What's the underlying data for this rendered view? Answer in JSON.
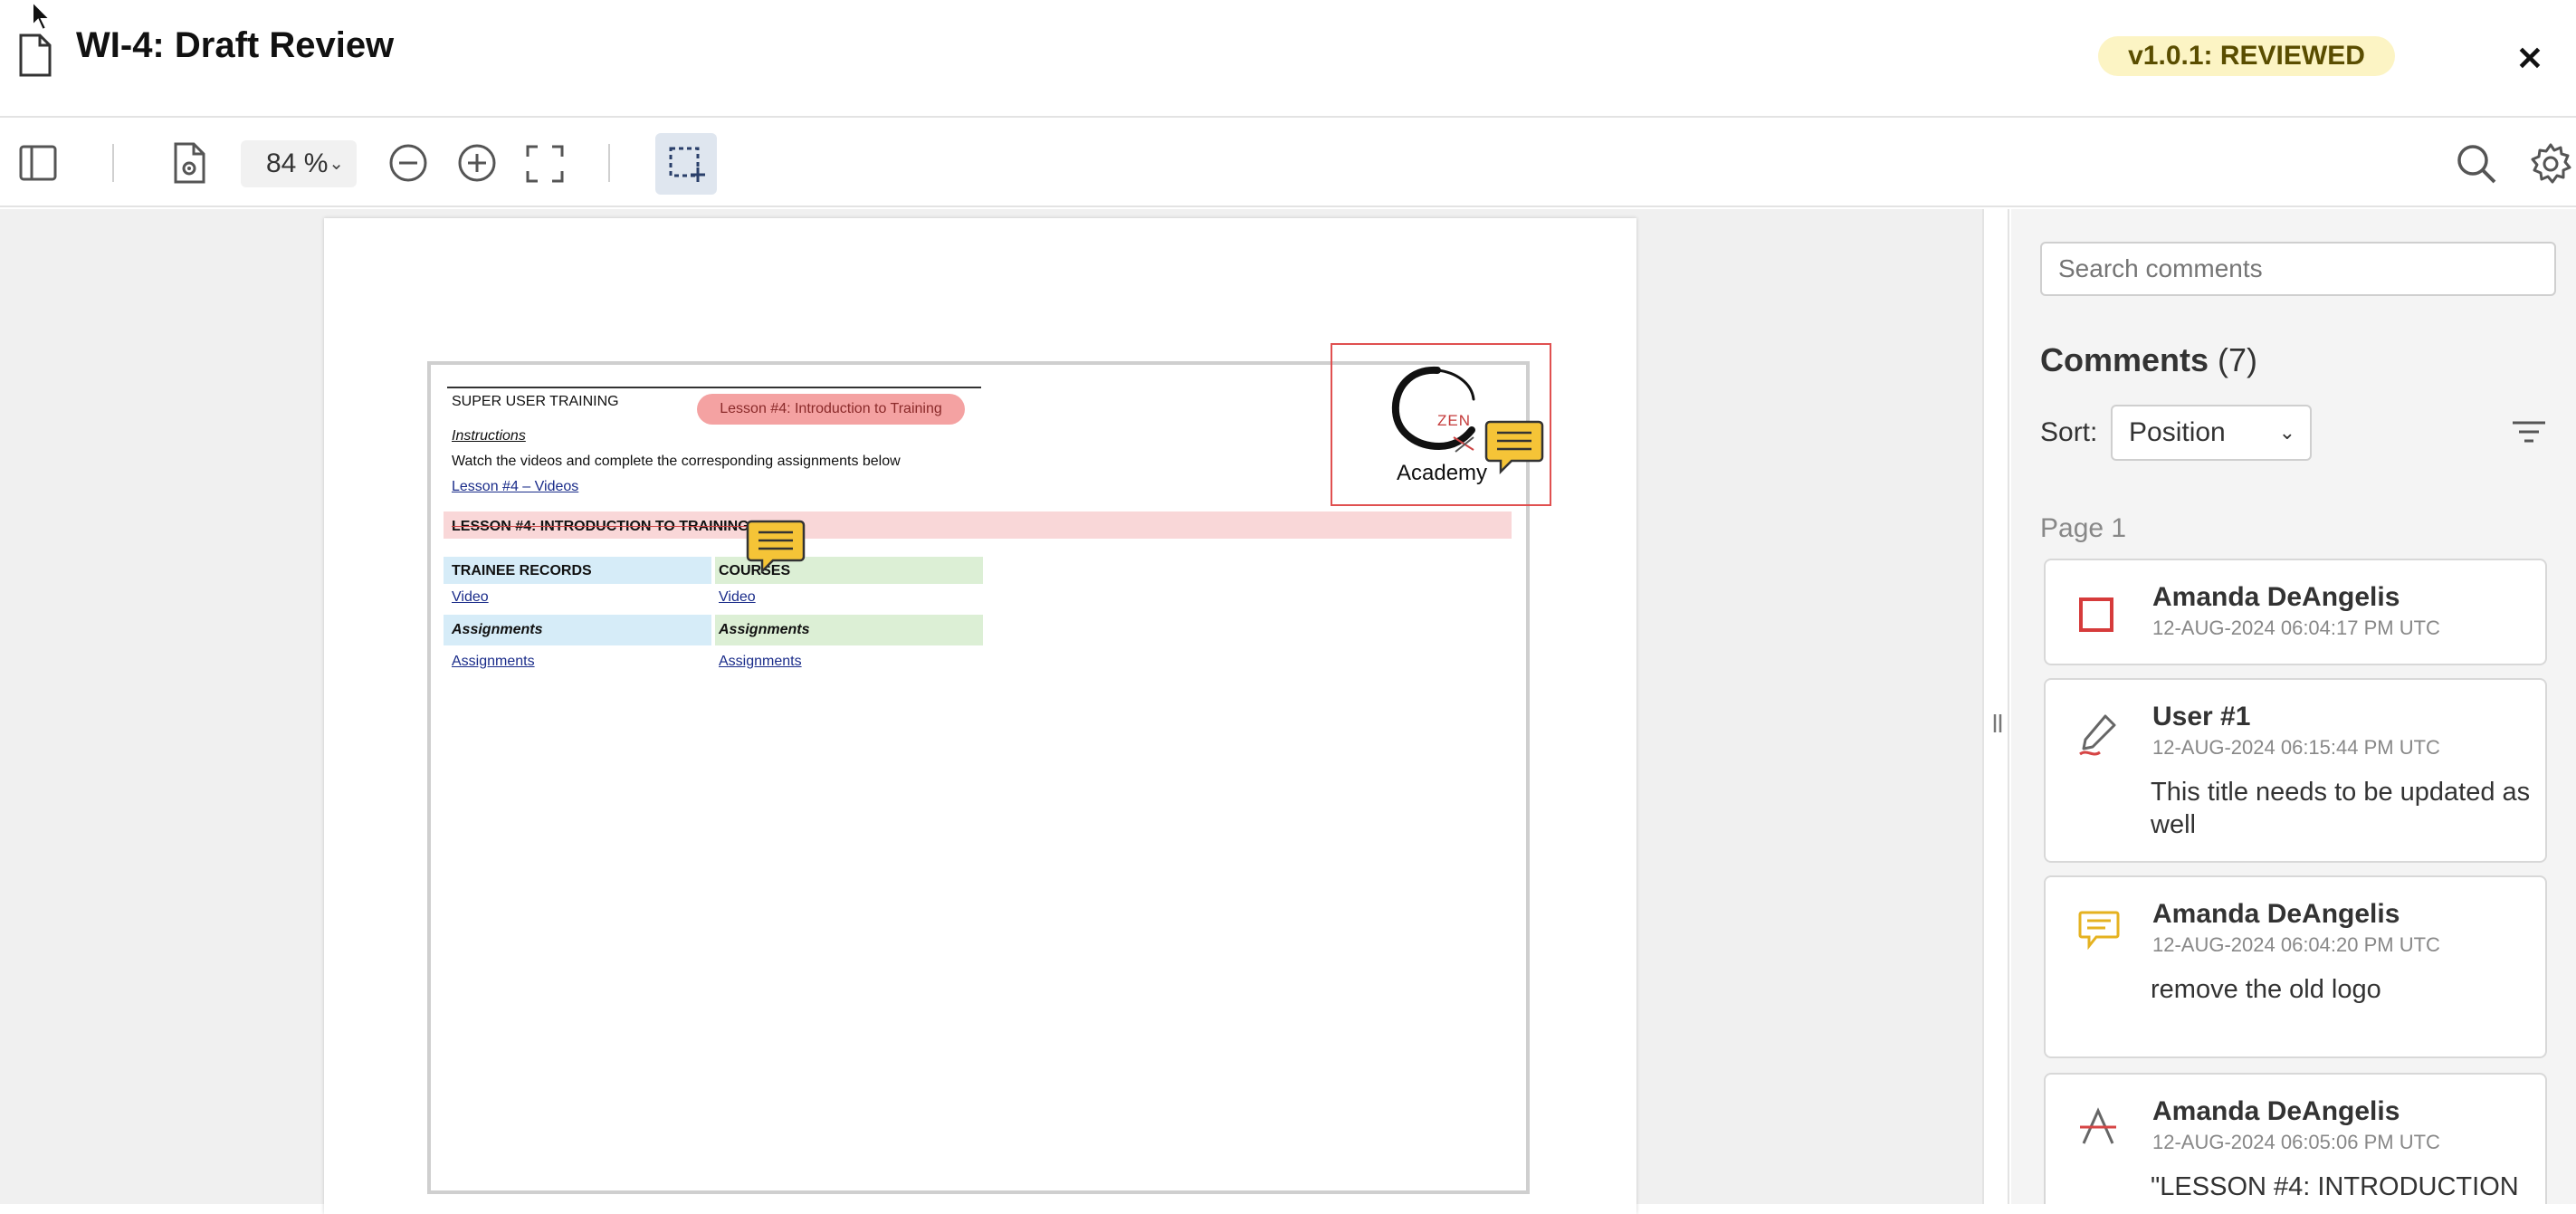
{
  "window": {
    "title": "WI-4: Draft Review",
    "version_badge": "v1.0.1: REVIEWED",
    "close_label": "✕"
  },
  "toolbar": {
    "zoom_value": "84 %",
    "icons": [
      "sidebar-toggle-icon",
      "document-settings-icon",
      "zoom-out-icon",
      "zoom-in-icon",
      "fit-page-icon",
      "area-select-icon",
      "search-icon",
      "gear-icon"
    ]
  },
  "document": {
    "header_left": "SUPER USER TRAINING",
    "header_pill": "Lesson #4: Introduction to Training",
    "instructions_label": "Instructions",
    "instructions_text": "Watch the videos and complete the corresponding assignments below",
    "videos_link": "Lesson #4 – Videos",
    "lesson_heading": "LESSON #4: INTRODUCTION TO TRAINING",
    "col1_header": "TRAINEE RECORDS",
    "col2_header": "COURSES",
    "col1_video": "Video",
    "col2_video": "Video",
    "col1_assign_header": "Assignments",
    "col2_assign_header": "Assignments",
    "col1_assign_link": "Assignments",
    "col2_assign_link": "Assignments",
    "logo_top": "ZEN",
    "logo_bottom": "Academy"
  },
  "comments": {
    "search_placeholder": "Search comments",
    "heading": "Comments",
    "count": "(7)",
    "sort_label": "Sort:",
    "sort_value": "Position",
    "page_label": "Page 1",
    "items": [
      {
        "author": "Amanda DeAngelis",
        "time": "12-AUG-2024 06:04:17 PM UTC",
        "body": "",
        "icon": "rectangle-annotation-icon"
      },
      {
        "author": "User #1",
        "time": "12-AUG-2024 06:15:44 PM UTC",
        "body": "This title needs to be updated as well",
        "icon": "freehand-pen-icon"
      },
      {
        "author": "Amanda DeAngelis",
        "time": "12-AUG-2024 06:04:20 PM UTC",
        "body": "remove the old logo",
        "icon": "note-comment-icon"
      },
      {
        "author": "Amanda DeAngelis",
        "time": "12-AUG-2024 06:05:06 PM UTC",
        "body": "\"LESSON #4: INTRODUCTION",
        "icon": "strikeout-icon"
      }
    ]
  },
  "colors": {
    "badge_bg": "#fcf4c4",
    "rect_annotation": "#d63b3b",
    "note_yellow": "#f5c437",
    "strike_red": "#d64545"
  }
}
